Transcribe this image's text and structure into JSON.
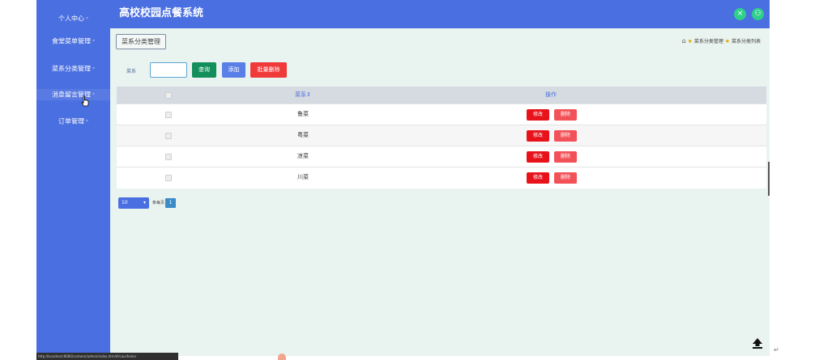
{
  "app": {
    "title": "高校校园点餐系统"
  },
  "sidebar": {
    "items": [
      {
        "label": "个人中心"
      },
      {
        "label": "食堂菜单管理"
      },
      {
        "label": "菜系分类管理"
      },
      {
        "label": "消息留言管理"
      },
      {
        "label": "订单管理"
      }
    ]
  },
  "header": {
    "icon_left": "×",
    "icon_right": "⚇"
  },
  "main": {
    "page_tag": "菜系分类管理",
    "breadcrumb": {
      "crumb1": "菜系分类管理",
      "crumb2": "菜系分类列表"
    },
    "search": {
      "label": "菜系",
      "value": "",
      "placeholder": ""
    },
    "buttons": {
      "search": "查询",
      "add": "添加",
      "batch_delete": "批量删除"
    },
    "table": {
      "columns": {
        "name": "菜系",
        "actions": "操作"
      },
      "rows": [
        {
          "name": "鲁菜",
          "edit": "修改",
          "delete": "删除"
        },
        {
          "name": "粤菜",
          "edit": "修改",
          "delete": "删除"
        },
        {
          "name": "凉菜",
          "edit": "修改",
          "delete": "删除"
        },
        {
          "name": "川菜",
          "edit": "修改",
          "delete": "删除"
        }
      ]
    },
    "pagination": {
      "page_size": "10",
      "per_page_label": "条每页",
      "current_page": "1"
    }
  },
  "status_bar": {
    "text": "http://localhost:8080/canteen/admin/index.html#/caixifenlei"
  },
  "colors": {
    "accent": "#4a6fe0",
    "main_bg": "#e9f3ef",
    "search_btn": "#138f5b",
    "delete_btn": "#f03a3a"
  }
}
